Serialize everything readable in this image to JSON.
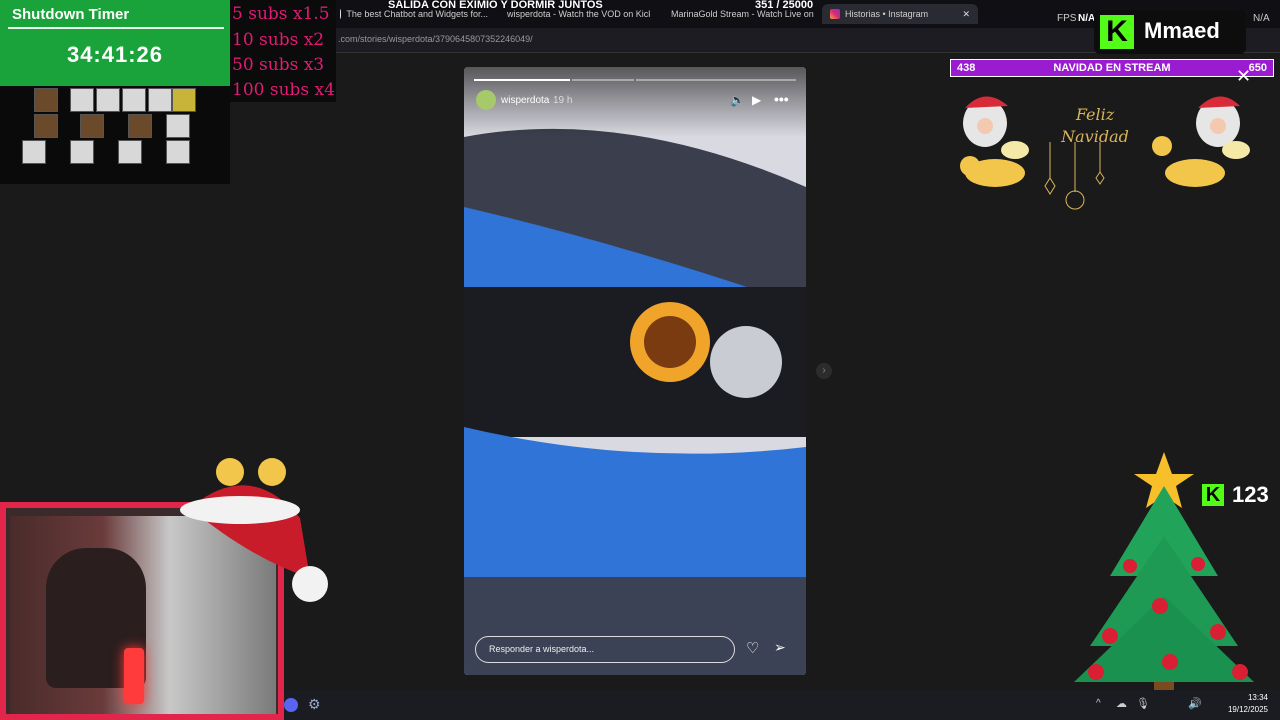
{
  "browser": {
    "tabs": [
      {
        "label": "The best Chatbot and Widgets for..."
      },
      {
        "label": "wisperdota - Watch the VOD on Kick"
      },
      {
        "label": "MarinaGold Stream - Watch Live on..."
      },
      {
        "label": "Historias • Instagram",
        "active": true
      }
    ],
    "url": ".com/stories/wisperdota/3790645807352246049/"
  },
  "overlay": {
    "timer_title": "Shutdown Timer",
    "timer_value": "34:41:26",
    "sub_multipliers": [
      "5 subs x1.5",
      "10 subs x2",
      "50 subs x3",
      "100 subs x4"
    ],
    "stream_title": "SALIDA CON EXIMIO Y DORMIR JUNTOS",
    "sub_goal": "351 / 25000",
    "fps_label": "FPS",
    "fps_value": "N/A",
    "right_value": "N/A",
    "kick_channel": "Mmaed",
    "progress": {
      "left": "438",
      "center": "NAVIDAD EN STREAM",
      "right": "650"
    },
    "feliz_navidad": "Feliz Navidad",
    "kick_counter": "123"
  },
  "story": {
    "username": "wisperdota",
    "time_ago": "19 h",
    "reply_placeholder": "Responder a wisperdota...",
    "progress_segments": 3,
    "active_segment": 1
  },
  "taskbar": {
    "time": "13:34",
    "date": "19/12/2025"
  },
  "colors": {
    "timer_green": "#1aa33b",
    "subs_pink": "#e11b74",
    "kick_green": "#53fc18",
    "progress_purple": "#9b1bd1",
    "webcam_border": "#e2254a"
  }
}
